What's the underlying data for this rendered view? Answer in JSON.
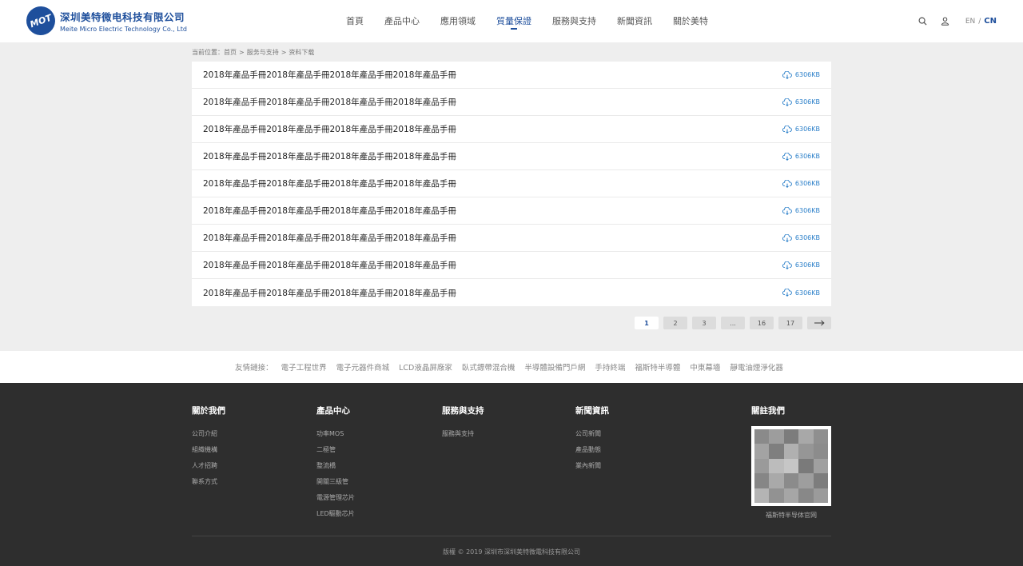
{
  "brand": {
    "badge": "MOT",
    "name_cn": "深圳美特微电科技有限公司",
    "name_en": "Meite Micro Electric Technology Co., Ltd",
    "color": "#1e4f9c"
  },
  "nav": {
    "items": [
      {
        "label": "首頁"
      },
      {
        "label": "產品中心"
      },
      {
        "label": "應用領域"
      },
      {
        "label": "質量保證"
      },
      {
        "label": "服務與支持"
      },
      {
        "label": "新聞資訊"
      },
      {
        "label": "關於美特"
      }
    ],
    "active_index": 3
  },
  "header_tools": {
    "search_icon": "search-icon",
    "user_icon": "user-icon",
    "lang_en": "EN",
    "lang_sep": "/",
    "lang_cn": "CN"
  },
  "breadcrumb": {
    "prefix": "当前位置：",
    "items": [
      "首页",
      "服务与支持",
      "资料下载"
    ],
    "sep": ">"
  },
  "downloads": [
    {
      "title": "2018年產品手冊2018年產品手冊2018年產品手冊2018年產品手冊",
      "size": "6306KB"
    },
    {
      "title": "2018年產品手冊2018年產品手冊2018年產品手冊2018年產品手冊",
      "size": "6306KB"
    },
    {
      "title": "2018年產品手冊2018年產品手冊2018年產品手冊2018年產品手冊",
      "size": "6306KB"
    },
    {
      "title": "2018年產品手冊2018年產品手冊2018年產品手冊2018年產品手冊",
      "size": "6306KB"
    },
    {
      "title": "2018年產品手冊2018年產品手冊2018年產品手冊2018年產品手冊",
      "size": "6306KB"
    },
    {
      "title": "2018年產品手冊2018年產品手冊2018年產品手冊2018年產品手冊",
      "size": "6306KB"
    },
    {
      "title": "2018年產品手冊2018年產品手冊2018年產品手冊2018年產品手冊",
      "size": "6306KB"
    },
    {
      "title": "2018年產品手冊2018年產品手冊2018年產品手冊2018年產品手冊",
      "size": "6306KB"
    },
    {
      "title": "2018年產品手冊2018年產品手冊2018年產品手冊2018年產品手冊",
      "size": "6306KB"
    }
  ],
  "pagination": {
    "pages": [
      "1",
      "2",
      "3",
      "...",
      "16",
      "17"
    ],
    "current": "1",
    "next_icon": "arrow-right-icon"
  },
  "friend_links": {
    "label": "友情鏈接：",
    "items": [
      "電子工程世界",
      "電子元器件商城",
      "LCD液晶屏廠家",
      "臥式鏢帶混合機",
      "半導體設備門戶網",
      "手持終端",
      "福斯特半導體",
      "中東幕墻",
      "靜電油煙淨化器"
    ]
  },
  "footer": {
    "columns": [
      {
        "title": "關於我們",
        "links": [
          "公司介紹",
          "組織機構",
          "人才招聘",
          "聯系方式"
        ]
      },
      {
        "title": "產品中心",
        "links": [
          "功率MOS",
          "二極管",
          "整流橋",
          "開關三級管",
          "電源管理芯片",
          "LED驅動芯片"
        ]
      },
      {
        "title": "服務與支持",
        "links": [
          "服務與支持"
        ]
      },
      {
        "title": "新聞資訊",
        "links": [
          "公司新聞",
          "產品動態",
          "業內新聞"
        ]
      }
    ],
    "follow": {
      "title": "關註我們",
      "qr_caption": "福斯特半导体官网"
    },
    "copyright": "版權 © 2019 深圳市深圳美特微電科技有限公司"
  },
  "colors": {
    "accent": "#1e4f9c",
    "download_blue": "#2a7fc9",
    "footer_bg": "#2e2e2e",
    "page_bg": "#eeeeee"
  }
}
